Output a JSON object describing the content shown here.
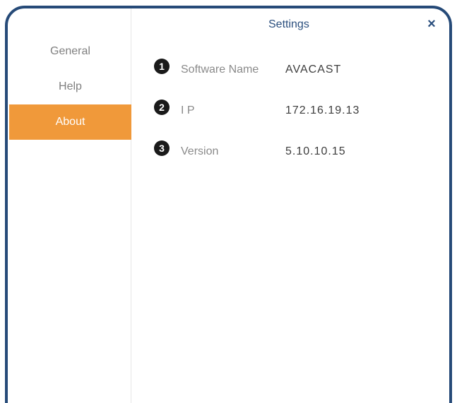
{
  "window": {
    "title": "Settings",
    "close_label": "×"
  },
  "sidebar": {
    "items": [
      {
        "label": "General",
        "active": false
      },
      {
        "label": "Help",
        "active": false
      },
      {
        "label": "About",
        "active": true
      }
    ]
  },
  "about": {
    "rows": [
      {
        "badge": "1",
        "label": "Software Name",
        "value": "AVACAST"
      },
      {
        "badge": "2",
        "label": "I P",
        "value": "172.16.19.13"
      },
      {
        "badge": "3",
        "label": "Version",
        "value": "5.10.10.15"
      }
    ]
  },
  "colors": {
    "frame": "#264a78",
    "accent": "#f0993a",
    "title": "#2b4f7e"
  }
}
